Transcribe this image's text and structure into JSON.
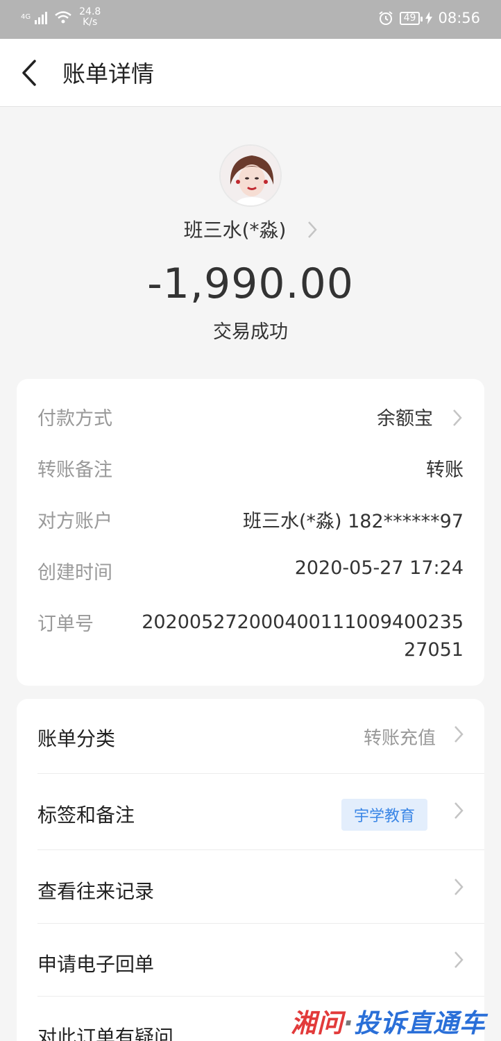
{
  "status_bar": {
    "network": "4G",
    "speed_value": "24.8",
    "speed_unit": "K/s",
    "battery": "49",
    "time": "08:56"
  },
  "header": {
    "title": "账单详情"
  },
  "summary": {
    "payee": "班三水(*淼)",
    "amount": "-1,990.00",
    "status": "交易成功"
  },
  "details": {
    "payment_method_label": "付款方式",
    "payment_method_value": "余额宝",
    "note_label": "转账备注",
    "note_value": "转账",
    "account_label": "对方账户",
    "account_value": "班三水(*淼) 182******97",
    "created_label": "创建时间",
    "created_value": "2020-05-27 17:24",
    "order_label": "订单号",
    "order_value": "20200527200040011100940023527051"
  },
  "actions": {
    "category_label": "账单分类",
    "category_value": "转账充值",
    "tags_label": "标签和备注",
    "tag_value": "宇学教育",
    "history_label": "查看往来记录",
    "receipt_label": "申请电子回单",
    "dispute_label": "对此订单有疑问"
  },
  "watermark": {
    "part1": "湘问",
    "sep": "·",
    "part2": "投诉直通车"
  },
  "colors": {
    "status_bar": "#b4b4b4",
    "tag_bg": "#e3eefc",
    "tag_text": "#3a86e6"
  }
}
